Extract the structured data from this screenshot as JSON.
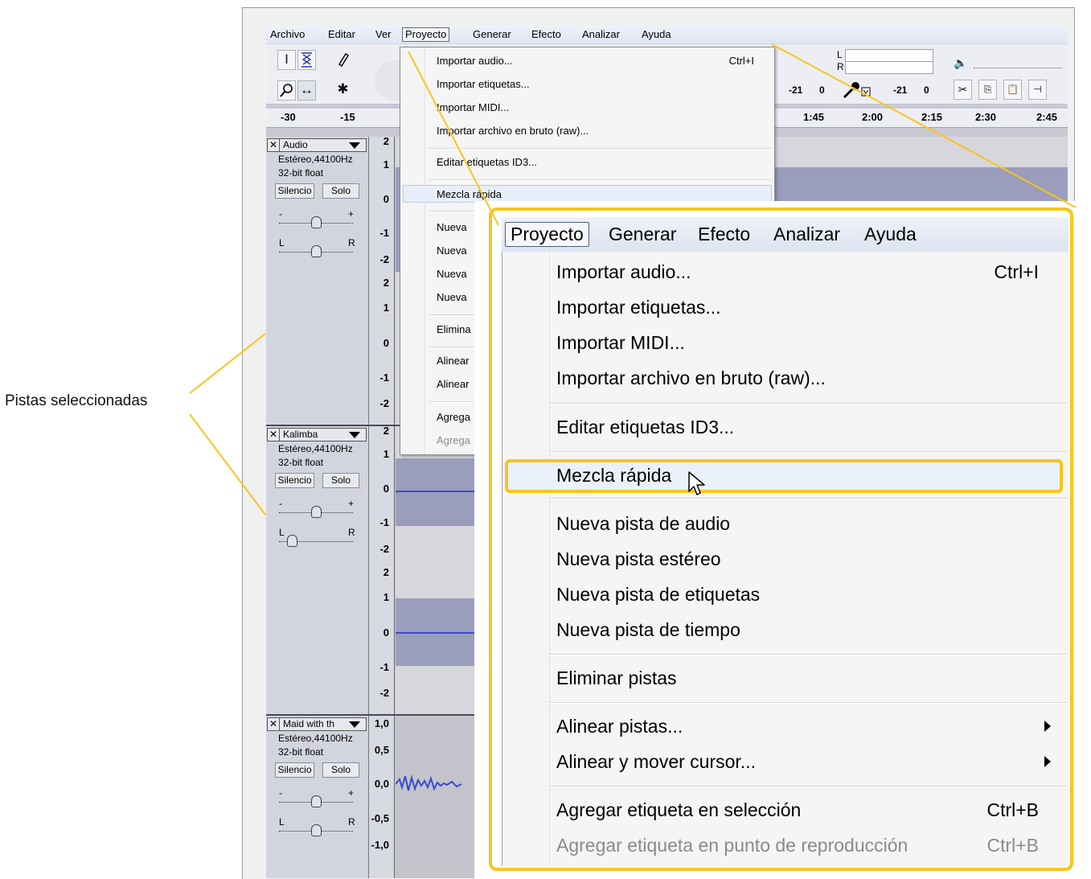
{
  "annotation": {
    "label": "Pistas seleccionadas",
    "line_color": "#f7c51f"
  },
  "menubar": {
    "items": [
      "Archivo",
      "Editar",
      "Ver",
      "Proyecto",
      "Generar",
      "Efecto",
      "Analizar",
      "Ayuda"
    ],
    "active": "Proyecto"
  },
  "toolbar": {
    "tools": [
      "selection-tool",
      "envelope-tool",
      "draw-tool",
      "zoom-tool",
      "timeshift-tool",
      "multi-tool"
    ],
    "meter_l": "L",
    "meter_r": "R",
    "play_db": "-21",
    "play_db2": "0",
    "rec_db": "-21",
    "rec_db2": "0"
  },
  "ruler": {
    "ticks": [
      "-30",
      "-15",
      "1:45",
      "2:00",
      "2:15",
      "2:30",
      "2:45"
    ]
  },
  "tracks": [
    {
      "name": "Audio",
      "format": "Estéreo,44100Hz",
      "bitdepth": "32-bit float",
      "mute": "Silencio",
      "solo": "Solo",
      "scale": [
        "2",
        "1",
        "0",
        "-1",
        "-2"
      ]
    },
    {
      "name": "Kalimba",
      "format": "Estéreo,44100Hz",
      "bitdepth": "32-bit float",
      "mute": "Silencio",
      "solo": "Solo",
      "scale": [
        "2",
        "1",
        "0",
        "-1",
        "-2"
      ],
      "scale2": [
        "2",
        "1",
        "0",
        "-1",
        "-2"
      ]
    },
    {
      "name": "Maid with th",
      "format": "Estéreo,44100Hz",
      "bitdepth": "32-bit float",
      "mute": "Silencio",
      "solo": "Solo",
      "scale": [
        "1,0",
        "0,5",
        "0,0",
        "-0,5",
        "-1,0"
      ]
    }
  ],
  "slider_labels": {
    "gain_minus": "-",
    "gain_plus": "+",
    "pan_l": "L",
    "pan_r": "R"
  },
  "small_menu": {
    "items": [
      {
        "label": "Importar audio...",
        "shortcut": "Ctrl+I"
      },
      {
        "label": "Importar etiquetas..."
      },
      {
        "label": "Importar MIDI..."
      },
      {
        "label": "Importar archivo en bruto (raw)..."
      },
      {
        "label": "Editar etiquetas ID3..."
      },
      {
        "label": "Mezcla rápida"
      },
      {
        "label": "Nueva"
      },
      {
        "label": "Nueva"
      },
      {
        "label": "Nueva"
      },
      {
        "label": "Nueva"
      },
      {
        "label": "Elimina"
      },
      {
        "label": "Alinear"
      },
      {
        "label": "Alinear"
      },
      {
        "label": "Agrega"
      },
      {
        "label": "Agrega"
      }
    ]
  },
  "zoom": {
    "menubar": [
      "Proyecto",
      "Generar",
      "Efecto",
      "Analizar",
      "Ayuda"
    ],
    "items": {
      "import_audio": "Importar audio...",
      "import_audio_sc": "Ctrl+I",
      "import_labels": "Importar etiquetas...",
      "import_midi": "Importar MIDI...",
      "import_raw": "Importar archivo en bruto (raw)...",
      "edit_id3": "Editar etiquetas ID3...",
      "quick_mix": "Mezcla rápida",
      "new_audio": "Nueva pista de audio",
      "new_stereo": "Nueva pista estéreo",
      "new_label": "Nueva pista de etiquetas",
      "new_time": "Nueva pista de tiempo",
      "remove": "Eliminar pistas",
      "align": "Alinear pistas...",
      "align_move": "Alinear y mover cursor...",
      "add_label_sel": "Agregar etiqueta en selección",
      "add_label_sel_sc": "Ctrl+B",
      "add_label_play": "Agregar etiqueta en punto de reproducción",
      "add_label_play_sc": "Ctrl+B"
    }
  }
}
